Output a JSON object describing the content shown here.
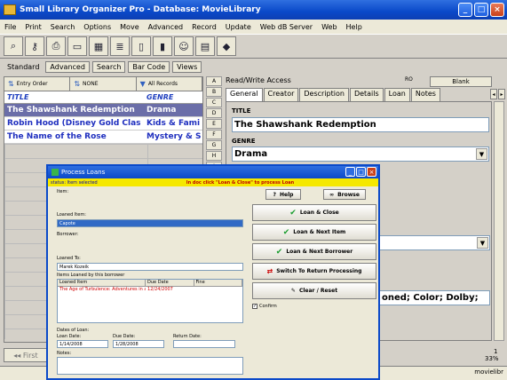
{
  "window": {
    "title": "Small Library Organizer Pro - Database: MovieLibrary"
  },
  "menu": [
    "File",
    "Print",
    "Search",
    "Options",
    "Move",
    "Advanced",
    "Record",
    "Update",
    "Web dB Server",
    "Web",
    "Help"
  ],
  "toolbar_icons": [
    "search-icon",
    "key-icon",
    "print-icon",
    "monitor-icon",
    "table-icon",
    "list-icon",
    "page-icon",
    "chart-icon",
    "users-icon",
    "spreadsheet-icon",
    "bookmark-icon"
  ],
  "view_tabs": [
    "Standard",
    "Advanced",
    "Search",
    "Bar Code",
    "Views"
  ],
  "list": {
    "sort_buttons": [
      "Entry Order",
      "NONE",
      "All Records"
    ],
    "columns": [
      "TITLE",
      "GENRE"
    ],
    "rows": [
      {
        "title": "The Shawshank Redemption",
        "genre": "Drama"
      },
      {
        "title": "Robin Hood (Disney Gold Clas",
        "genre": "Kids & Fami"
      },
      {
        "title": "The Name of the Rose",
        "genre": "Mystery & S"
      }
    ],
    "selected_row": 0
  },
  "detail": {
    "access_label": "Read/Write Access",
    "r_label": "RO",
    "blank_button": "Blank",
    "tabs": [
      "General",
      "Creator",
      "Description",
      "Details",
      "Loan",
      "Notes"
    ],
    "active_tab": "General",
    "title_label": "TITLE",
    "title_value": "The Shawshank Redemption",
    "genre_label": "GENRE",
    "genre_value": "Drama",
    "extra_value": "oned; Color; Dolby;"
  },
  "alpha_index": [
    "A",
    "B",
    "C",
    "D",
    "E",
    "F",
    "G",
    "H",
    "I",
    "J",
    "K",
    "L",
    "M",
    "N",
    "O",
    "P",
    "Q",
    "R",
    "S",
    "T",
    "U"
  ],
  "bottom": {
    "first_button": "First",
    "record_count": "1",
    "percent": "33%",
    "db_name": "movielibr"
  },
  "dialog": {
    "title": "Process Loans",
    "status_left": "status: Item selected",
    "status_right": "In doc click \"Loan & Close\" to process Loan",
    "item_label": "Item:",
    "help_button": "Help",
    "browse_button": "Browse",
    "loaned_item_label": "Loaned Item:",
    "loaned_item_value": "Capote",
    "borrower_label": "Borrower:",
    "loaned_to_label": "Loaned To:",
    "loaned_to_value": "Marek Kozeik",
    "items_loaned_label": "Items Loaned by this borrower",
    "table_headers": [
      "Loaned Item",
      "Due Date",
      "Fine"
    ],
    "table_row": {
      "item": "The Age of Turbulence: Adventures in a ...",
      "date": "12/24/2007",
      "fine": ""
    },
    "dates_label": "Dates of Loan:",
    "loan_date_label": "Loan Date:",
    "loan_date_value": "1/14/2008",
    "due_date_label": "Due Date:",
    "due_date_value": "1/28/2008",
    "return_date_label": "Return Date:",
    "notes_label": "Notes:",
    "buttons": {
      "loan_close": "Loan & Close",
      "loan_next_item": "Loan & Next Item",
      "loan_next_borrower": "Loan & Next Borrower",
      "switch_return": "Switch To Return Processing",
      "clear_reset": "Clear / Reset"
    },
    "confirm_label": "Confirm"
  }
}
